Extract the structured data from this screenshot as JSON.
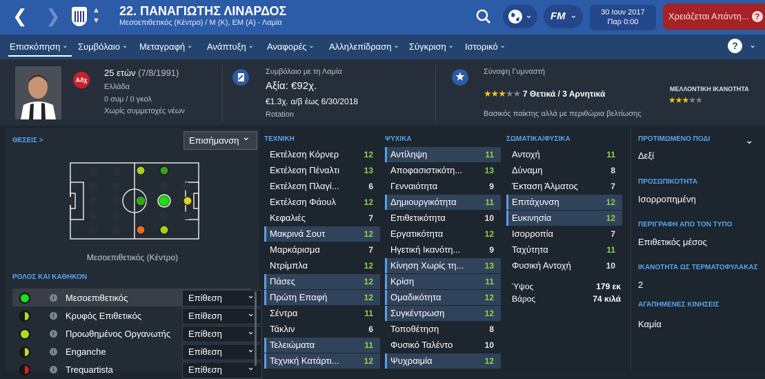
{
  "header": {
    "back_icon": "chevron-left-icon",
    "forward_icon": "chevron-right-icon",
    "title": "22. ΠΑΝΑΓΙΩΤΗΣ ΛΙΝΑΡΔΟΣ",
    "subtitle": "Μεσοεπιθετικός (Κέντρο) / Μ (Κ), ΕΜ (Α) - Λαμία",
    "date_line1": "30 Ιουν 2017",
    "date_line2": "Παρ 0:00",
    "fm_label": "FM",
    "alert": "Χρειάζεται Απάντη...",
    "alert_q": "?"
  },
  "menu": {
    "items": [
      "Επισκόπηση",
      "Συμβόλαιο",
      "Μεταγραφή",
      "Ανάπτυξη",
      "Αναφορές",
      "Αλληλεπίδραση",
      "Σύγκριση",
      "Ιστορικό"
    ],
    "active": 0,
    "help": "?"
  },
  "profile": {
    "age": "25 ετών",
    "dob": "(7/8/1991)",
    "nation": "Ελλάδα",
    "caps": "0 συμ / 0 γκολ",
    "youth": "Χωρίς συμμετοχές νέων",
    "nation_badge": "Αδχ"
  },
  "contract": {
    "label": "Συμβόλαιο με τη Λαμία",
    "value": "Αξία: €92χ.",
    "wage": "€1.3χ. α/β έως 6/30/2018",
    "status": "Rotation"
  },
  "scout": {
    "label": "Σύνοψη Γυμναστή",
    "current_stars": 3,
    "max_stars": 5,
    "summary": "7 Θετικά / 3 Αρνητικά",
    "desc": "Βασικός παίκτης αλλά με περιθώρια βελτίωσης",
    "potential_label": "ΜΕΛΛΟΝΤΙΚΗ ΙΚΑΝΟΤΗΤΑ",
    "potential_stars": 3
  },
  "positions": {
    "label": "ΘΕΣΕΙΣ >",
    "highlight": "Επισήμανση",
    "caption": "Μεσοεπιθετικός (Κέντρο)"
  },
  "roles": {
    "label": "ΡΟΛΟΣ ΚΑΙ ΚΑΘΗΚΟΝ",
    "items": [
      {
        "name": "Μεσοεπιθετικός",
        "duty": "Επίθεση",
        "color": "#19e020"
      },
      {
        "name": "Κρυφός Επιθετικός",
        "duty": "Επίθεση",
        "color": "#a8e020"
      },
      {
        "name": "Προωθημένος Οργανωτής",
        "duty": "Επίθεση",
        "color": "#a8e020"
      },
      {
        "name": "Enganche",
        "duty": "Επίθεση",
        "color": "#c8d820"
      },
      {
        "name": "Trequartista",
        "duty": "Επίθεση",
        "color": "#d82020"
      }
    ]
  },
  "technical": {
    "label": "ΤΕΧΝΙΚΗ",
    "rows": [
      {
        "n": "Εκτέλεση Κόρνερ",
        "v": "12"
      },
      {
        "n": "Εκτέλεση Πέναλτι",
        "v": "13"
      },
      {
        "n": "Εκτέλεση Πλαγί...",
        "v": "6"
      },
      {
        "n": "Εκτέλεση Φάουλ",
        "v": "12"
      },
      {
        "n": "Κεφαλιές",
        "v": "7"
      },
      {
        "n": "Μακρινά Σουτ",
        "v": "12"
      },
      {
        "n": "Μαρκάρισμα",
        "v": "7"
      },
      {
        "n": "Ντρίμπλα",
        "v": "12"
      },
      {
        "n": "Πάσες",
        "v": "12"
      },
      {
        "n": "Πρώτη Επαφή",
        "v": "12"
      },
      {
        "n": "Σέντρα",
        "v": "11"
      },
      {
        "n": "Τάκλιν",
        "v": "6"
      },
      {
        "n": "Τελειώματα",
        "v": "11"
      },
      {
        "n": "Τεχνική Κατάρτι...",
        "v": "12"
      }
    ]
  },
  "mental": {
    "label": "ΨΥΧΙΚΑ",
    "rows": [
      {
        "n": "Αντίληψη",
        "v": "11"
      },
      {
        "n": "Αποφασιστικότη...",
        "v": "13"
      },
      {
        "n": "Γενναιότητα",
        "v": "9"
      },
      {
        "n": "Δημιουργικότητα",
        "v": "11"
      },
      {
        "n": "Επιθετικότητα",
        "v": "10"
      },
      {
        "n": "Εργατικότητα",
        "v": "12"
      },
      {
        "n": "Ηγετική Ικανότη...",
        "v": "9"
      },
      {
        "n": "Κίνηση Χωρίς τη...",
        "v": "13"
      },
      {
        "n": "Κρίση",
        "v": "11"
      },
      {
        "n": "Ομαδικότητα",
        "v": "12"
      },
      {
        "n": "Συγκέντρωση",
        "v": "12"
      },
      {
        "n": "Τοποθέτηση",
        "v": "8"
      },
      {
        "n": "Φυσικό Ταλέντο",
        "v": "10"
      },
      {
        "n": "Ψυχραιμία",
        "v": "12"
      }
    ]
  },
  "physical": {
    "label": "ΣΩΜΑΤΙΚΑ/ΦΥΣΙΚΑ",
    "rows": [
      {
        "n": "Αντοχή",
        "v": "11"
      },
      {
        "n": "Δύναμη",
        "v": "8"
      },
      {
        "n": "Έκταση Άλματος",
        "v": "7"
      },
      {
        "n": "Επιτάχυνση",
        "v": "12"
      },
      {
        "n": "Ευκινησία",
        "v": "12"
      },
      {
        "n": "Ισορροπία",
        "v": "7"
      },
      {
        "n": "Ταχύτητα",
        "v": "11"
      },
      {
        "n": "Φυσική Αντοχή",
        "v": "10"
      }
    ],
    "height_label": "Ύψος",
    "height": "179 εκ",
    "weight_label": "Βάρος",
    "weight": "74 κιλά"
  },
  "side": [
    {
      "label": "ΠΡΟΤΙΜΩΜΕΝΟ ΠΟΔΙ",
      "value": "Δεξί"
    },
    {
      "label": "ΠΡΟΣΩΠΙΚΟΤΗΤΑ",
      "value": "Ισορροπημένη"
    },
    {
      "label": "ΠΕΡΙΓΡΑΦΗ ΑΠΟ ΤΟΝ ΤΥΠΟ",
      "value": "Επιθετικός μέσος"
    },
    {
      "label": "ΙΚΑΝΟΤΗΤΑ ΩΣ ΤΕΡΜΑΤΟΦΥΛΑΚΑΣ",
      "value": "2"
    },
    {
      "label": "ΑΓΑΠΗΜΕΝΕΣ ΚΙΝΗΣΕΙΣ",
      "value": "Καμία"
    }
  ]
}
